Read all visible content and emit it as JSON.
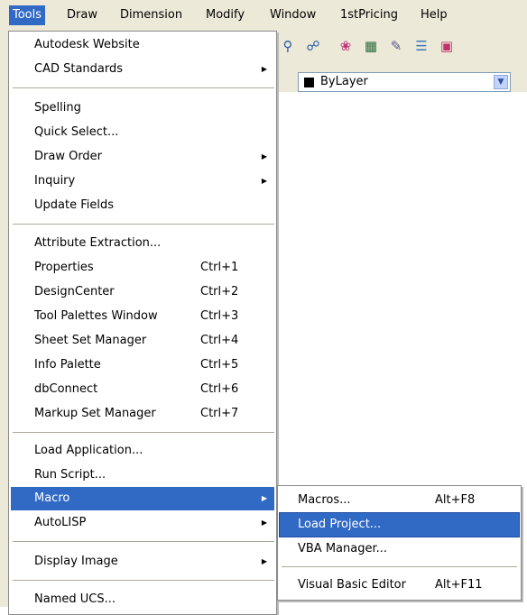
{
  "menubar": {
    "items": [
      "Tools",
      "Draw",
      "Dimension",
      "Modify",
      "Window",
      "1stPricing",
      "Help"
    ]
  },
  "toolbar": {
    "icons": [
      "zoom-icon",
      "pan-icon",
      "match-properties-icon",
      "block-icon",
      "edit-icon",
      "layer-icon",
      "refresh-icon"
    ],
    "layer_combo_value": "ByLayer"
  },
  "tools_menu": {
    "items": [
      {
        "label": "Autodesk Website",
        "shortcut": "",
        "submenu": false
      },
      {
        "label": "CAD Standards",
        "shortcut": "",
        "submenu": true
      },
      {
        "label": "Spelling",
        "shortcut": "",
        "submenu": false
      },
      {
        "label": "Quick Select...",
        "shortcut": "",
        "submenu": false
      },
      {
        "label": "Draw Order",
        "shortcut": "",
        "submenu": true
      },
      {
        "label": "Inquiry",
        "shortcut": "",
        "submenu": true
      },
      {
        "label": "Update Fields",
        "shortcut": "",
        "submenu": false
      },
      {
        "label": "Attribute Extraction...",
        "shortcut": "",
        "submenu": false
      },
      {
        "label": "Properties",
        "shortcut": "Ctrl+1",
        "submenu": false
      },
      {
        "label": "DesignCenter",
        "shortcut": "Ctrl+2",
        "submenu": false
      },
      {
        "label": "Tool Palettes Window",
        "shortcut": "Ctrl+3",
        "submenu": false
      },
      {
        "label": "Sheet Set Manager",
        "shortcut": "Ctrl+4",
        "submenu": false
      },
      {
        "label": "Info Palette",
        "shortcut": "Ctrl+5",
        "submenu": false
      },
      {
        "label": "dbConnect",
        "shortcut": "Ctrl+6",
        "submenu": false
      },
      {
        "label": "Markup Set Manager",
        "shortcut": "Ctrl+7",
        "submenu": false
      },
      {
        "label": "Load Application...",
        "shortcut": "",
        "submenu": false
      },
      {
        "label": "Run Script...",
        "shortcut": "",
        "submenu": false
      },
      {
        "label": "Macro",
        "shortcut": "",
        "submenu": true
      },
      {
        "label": "AutoLISP",
        "shortcut": "",
        "submenu": true
      },
      {
        "label": "Display Image",
        "shortcut": "",
        "submenu": true
      },
      {
        "label": "Named UCS...",
        "shortcut": "",
        "submenu": false
      }
    ]
  },
  "macro_menu": {
    "items": [
      {
        "label": "Macros...",
        "shortcut": "Alt+F8"
      },
      {
        "label": "Load Project...",
        "shortcut": ""
      },
      {
        "label": "VBA Manager...",
        "shortcut": ""
      },
      {
        "label": "Visual Basic Editor",
        "shortcut": "Alt+F11"
      }
    ]
  },
  "colors": {
    "highlight": "#316ac5",
    "menubar_bg": "#ece9d8",
    "separator": "#aca899"
  }
}
